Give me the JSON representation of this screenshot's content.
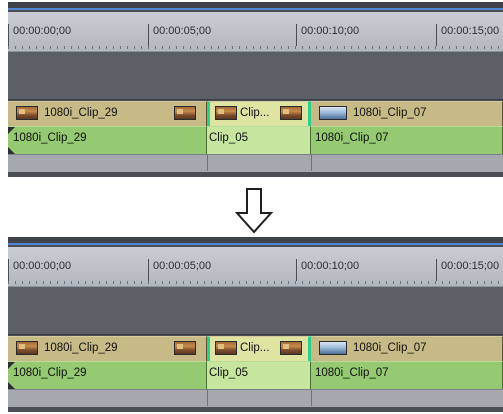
{
  "ruler": {
    "timecodes": [
      "00:00:00;00",
      "00:00:05;00",
      "00:00:10;00",
      "00:00:15;00"
    ]
  },
  "clips": {
    "clip_29": "1080i_Clip_29",
    "clip_05_video": "Clip...",
    "clip_05_audio": "Clip_05",
    "clip_07": "1080i_Clip_07"
  },
  "colors": {
    "video_track": "#c8ba86",
    "audio_track": "#95c972",
    "selection_edge": "#2fcf8a",
    "playhead_line": "#4f87d6"
  },
  "icons": [
    "film-thumbnail-icon",
    "down-arrow-icon",
    "clip-start-marker-icon"
  ]
}
